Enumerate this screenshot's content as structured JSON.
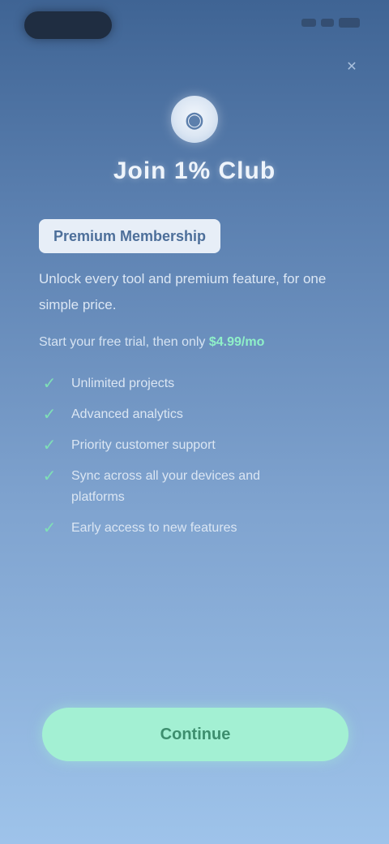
{
  "app": {
    "name": "Join 1% Club",
    "logo_glyph": "◉"
  },
  "close": {
    "icon": "close-icon",
    "glyph": "✕"
  },
  "badge": {
    "label": "Premium Membership"
  },
  "intro": {
    "text": "Unlock every tool and premium feature, for one simple price."
  },
  "sub": {
    "prefix": "Start your free trial, then only ",
    "highlight": "$4.99/mo"
  },
  "features": [
    {
      "label": "Unlimited projects"
    },
    {
      "label": "Advanced analytics"
    },
    {
      "label": "Priority customer support"
    },
    {
      "label": "Sync across all your devices and platforms"
    },
    {
      "label": "Early access to new features"
    }
  ],
  "cta": {
    "label": "Continue"
  },
  "colors": {
    "accent": "#a3f0d3",
    "check": "#7fe0b6",
    "background_top": "#3f6494",
    "background_bottom": "#9ec3ea"
  }
}
